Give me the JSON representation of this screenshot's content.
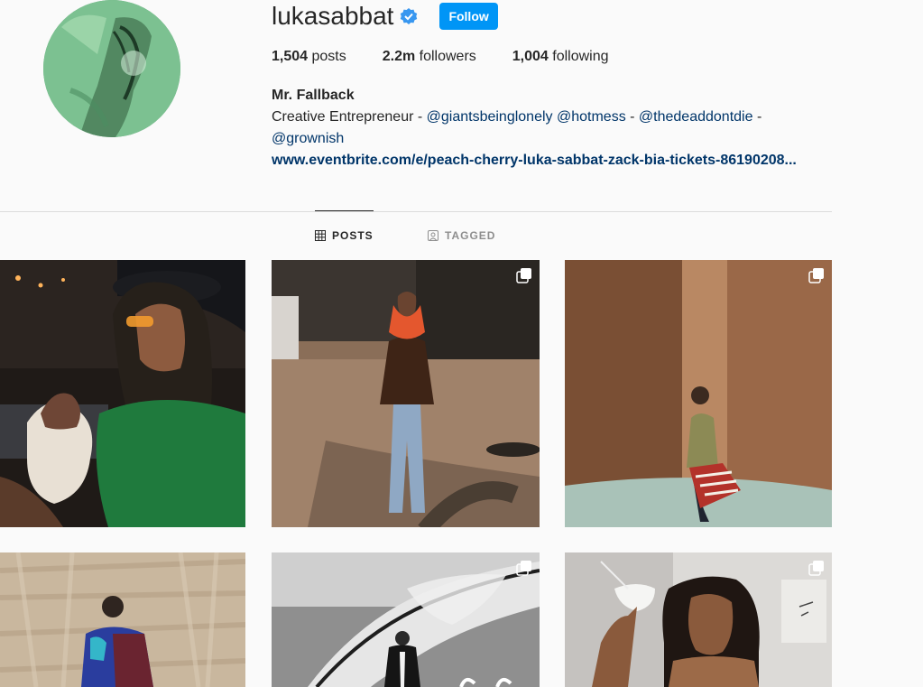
{
  "profile": {
    "username": "lukasabbat",
    "follow_label": "Follow",
    "stats": {
      "posts_count": "1,504",
      "posts_label": " posts",
      "followers_count": "2.2m",
      "followers_label": " followers",
      "following_count": "1,004",
      "following_label": " following"
    },
    "full_name": "Mr. Fallback",
    "bio_text": "Creative Entrepreneur - ",
    "bio_mentions": [
      "@giantsbeinglonely",
      "@hotmess",
      "@thedeaddontdie",
      "@grownish"
    ],
    "bio_separators": [
      " ",
      " - ",
      " - "
    ],
    "website": "www.eventbrite.com/e/peach-cherry-luka-sabbat-zack-bia-tickets-86190208..."
  },
  "tabs": [
    {
      "label": "POSTS",
      "icon": "grid-icon",
      "active": true
    },
    {
      "label": "TAGGED",
      "icon": "tag-portrait-icon",
      "active": false
    }
  ],
  "colors": {
    "accent": "#0095f6",
    "link": "#003569",
    "verified": "#3897f0"
  },
  "posts": [
    {
      "multi": false
    },
    {
      "multi": true
    },
    {
      "multi": true
    },
    {
      "multi": false
    },
    {
      "multi": true
    },
    {
      "multi": true
    }
  ]
}
